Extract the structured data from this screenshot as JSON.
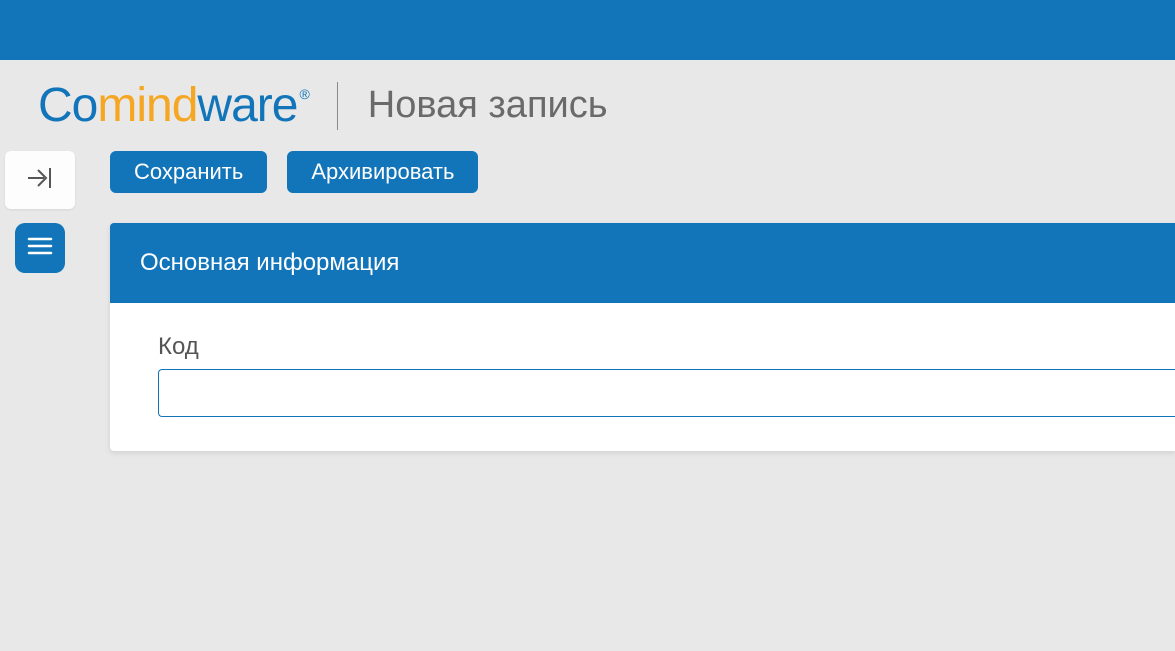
{
  "logo": {
    "part1": "Co",
    "part2": "mind",
    "part3": "ware",
    "reg": "®"
  },
  "page_title": "Новая запись",
  "toolbar": {
    "save_label": "Сохранить",
    "archive_label": "Архивировать"
  },
  "panel": {
    "header": "Основная информация",
    "field_code_label": "Код",
    "field_code_value": ""
  }
}
